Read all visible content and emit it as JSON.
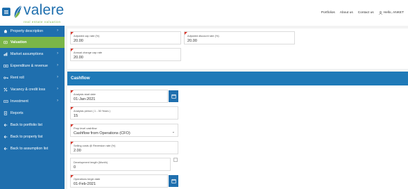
{
  "header": {
    "logo_word": "valere",
    "logo_tagline": "real estate valuation",
    "nav": {
      "portfolios": "Portfolios",
      "about": "About us",
      "contact": "Contact us",
      "user": "Hello, ANKET"
    }
  },
  "sidebar": {
    "items": [
      {
        "label": "Property description",
        "icon": "home-icon",
        "chevron": true,
        "active": false
      },
      {
        "label": "Valuation",
        "icon": "calculator-icon",
        "chevron": false,
        "active": true
      },
      {
        "label": "Market assumptions",
        "icon": "chart-icon",
        "chevron": true,
        "active": false
      },
      {
        "label": "Expenditure & revenue",
        "icon": "money-icon",
        "chevron": true,
        "active": false
      },
      {
        "label": "Rent roll",
        "icon": "key-icon",
        "chevron": true,
        "active": false
      },
      {
        "label": "Vacancy & credit loss",
        "icon": "percent-icon",
        "chevron": true,
        "active": false
      },
      {
        "label": "Investment",
        "icon": "investment-icon",
        "chevron": true,
        "active": false
      },
      {
        "label": "Reports",
        "icon": "report-icon",
        "chevron": false,
        "active": false
      },
      {
        "label": "Back to portfolio list",
        "icon": "arrow-left-icon",
        "chevron": false,
        "active": false
      },
      {
        "label": "Back to property list",
        "icon": "arrow-left-icon",
        "chevron": false,
        "active": false
      },
      {
        "label": "Back to assumption list",
        "icon": "arrow-left-icon",
        "chevron": false,
        "active": false
      }
    ]
  },
  "top_fields": {
    "adjusted_cap_rate": {
      "label": "Adjusted cap rate (%)",
      "value": "20.00"
    },
    "adjusted_discount_rate": {
      "label": "Adjusted discount rate (%)",
      "value": "20.00"
    },
    "annual_change_cap_rate": {
      "label": "Annual change cap rate",
      "value": "20.00"
    }
  },
  "cashflow": {
    "title": "Cashflow",
    "analysis_start_date": {
      "label": "Analysis start date",
      "value": "01-Jan-2021"
    },
    "analysis_period": {
      "label": "Analysis period ( 1 - 30 Years )",
      "value": "15"
    },
    "prop_level_cashflow": {
      "label": "Prop level cashflow",
      "value": "Cashflow from Operations (CFO)"
    },
    "selling_costs": {
      "label": "Selling costs @ Reversion rate (%)",
      "value": "2.00"
    },
    "development_length": {
      "label": "Development length (Month)",
      "value": "0"
    },
    "operations_begin_date": {
      "label": "Operations begin date",
      "value": "01-Feb-2021"
    }
  },
  "colors": {
    "primary": "#1f6fae",
    "accent_green": "#7ab648",
    "required_flag": "#d9362b"
  }
}
